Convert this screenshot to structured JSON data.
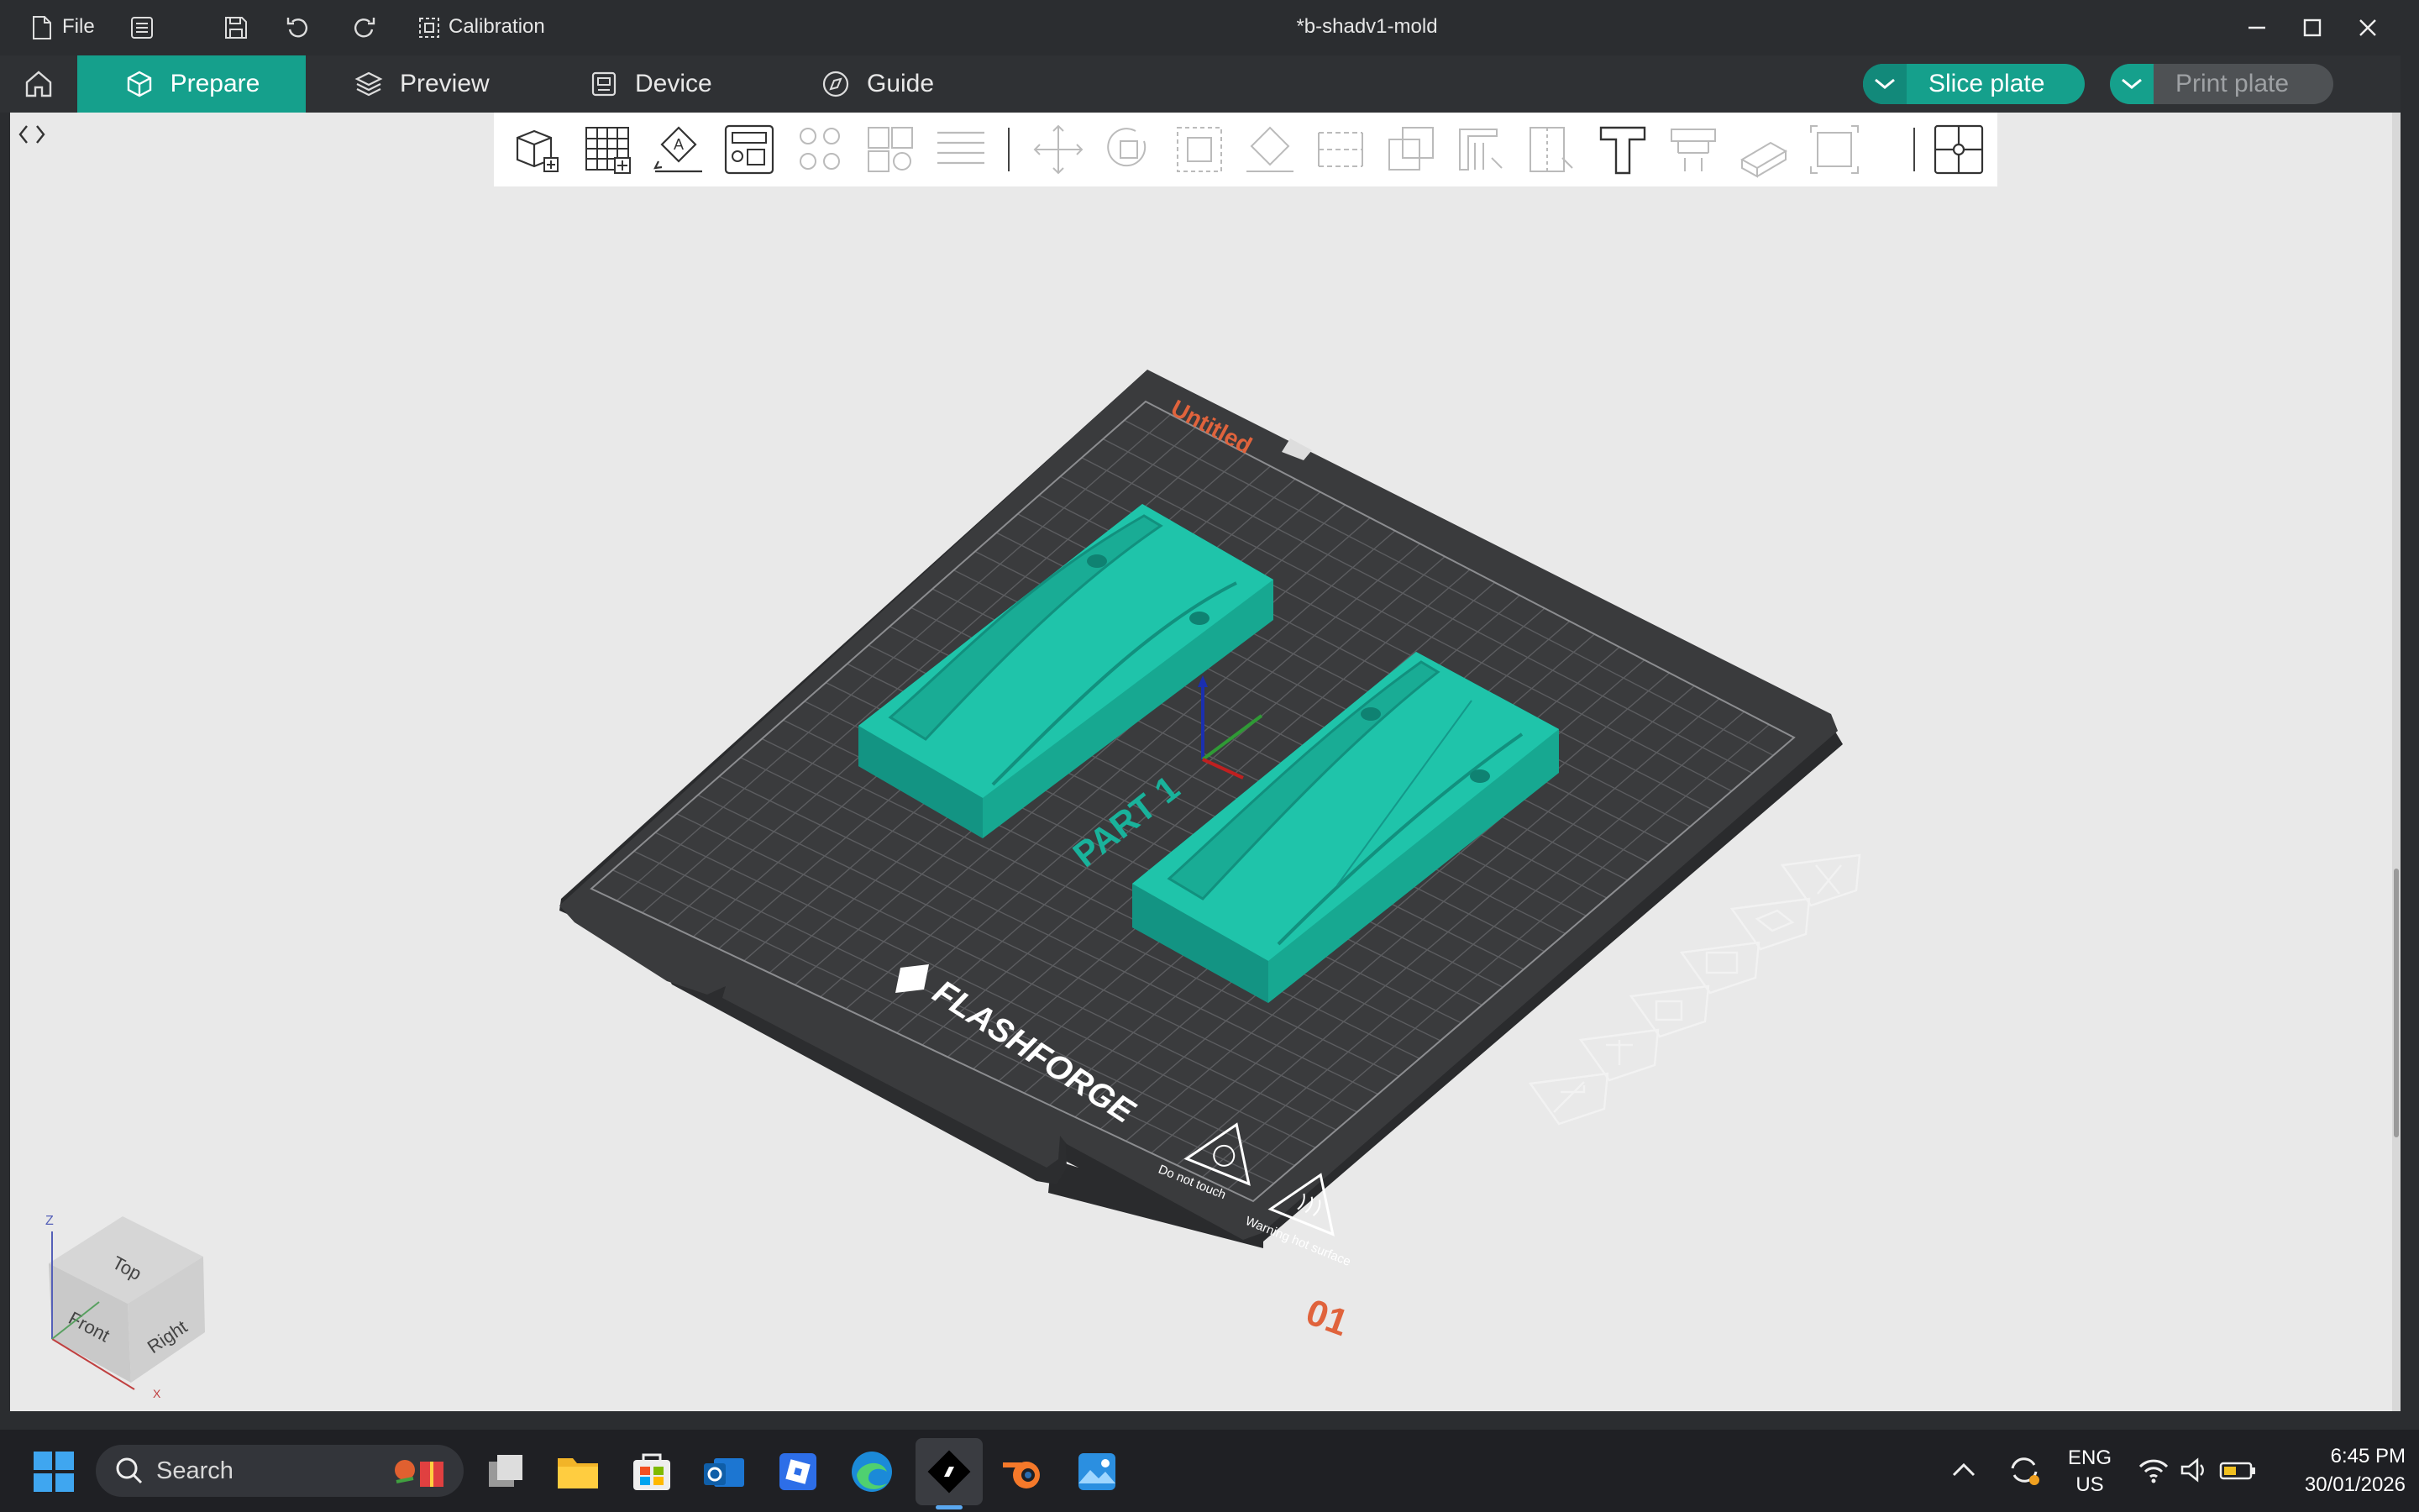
{
  "titlebar": {
    "file_label": "File",
    "calibration_label": "Calibration",
    "document_title": "*b-shadv1-mold",
    "icons": [
      "file-icon",
      "list-icon",
      "save-icon",
      "undo-icon",
      "redo-icon",
      "calibration-icon",
      "minimize-icon",
      "maximize-icon",
      "close-icon"
    ]
  },
  "nav": {
    "tabs": [
      {
        "label": "Prepare",
        "active": true
      },
      {
        "label": "Preview",
        "active": false
      },
      {
        "label": "Device",
        "active": false
      },
      {
        "label": "Guide",
        "active": false
      }
    ],
    "slice_label": "Slice plate",
    "print_label": "Print plate",
    "accent": "#15a08c"
  },
  "toolbar": {
    "items": [
      "add-object-icon",
      "add-plate-icon",
      "auto-orient-icon",
      "arrange-icon",
      "split-objects-icon",
      "split-parts-icon",
      "layers-icon",
      "move-icon",
      "rotate-icon",
      "scale-icon",
      "lay-on-face-icon",
      "cut-icon",
      "mesh-boolean-icon",
      "support-paint-icon",
      "seam-paint-icon",
      "text-icon",
      "measure-icon",
      "assembly-icon",
      "fit-view-icon",
      "brim-ears-icon"
    ]
  },
  "scene": {
    "plate_name": "Untitled",
    "plate_number": "01",
    "brand": "FLASHFORGE",
    "warning_do_not_touch": "Do not touch",
    "warning_hot_surface": "Warning hot surface",
    "part_label": "PART 1",
    "model_color": "#1fc4aa",
    "plate_color": "#3a3b3d",
    "plate_label_color": "#e0633c"
  },
  "view_cube": {
    "top": "Top",
    "front": "Front",
    "right": "Right",
    "axis_z": "Z",
    "axis_x": "X"
  },
  "taskbar": {
    "search_label": "Search",
    "language": "ENG",
    "region": "US",
    "time": "6:45 PM",
    "date": "30/01/2026",
    "apps": [
      "windows-start-icon",
      "task-view-icon",
      "file-explorer-icon",
      "store-icon",
      "outlook-icon",
      "roblox-icon",
      "edge-icon",
      "flashforge-icon",
      "blender-icon",
      "photos-icon"
    ]
  }
}
